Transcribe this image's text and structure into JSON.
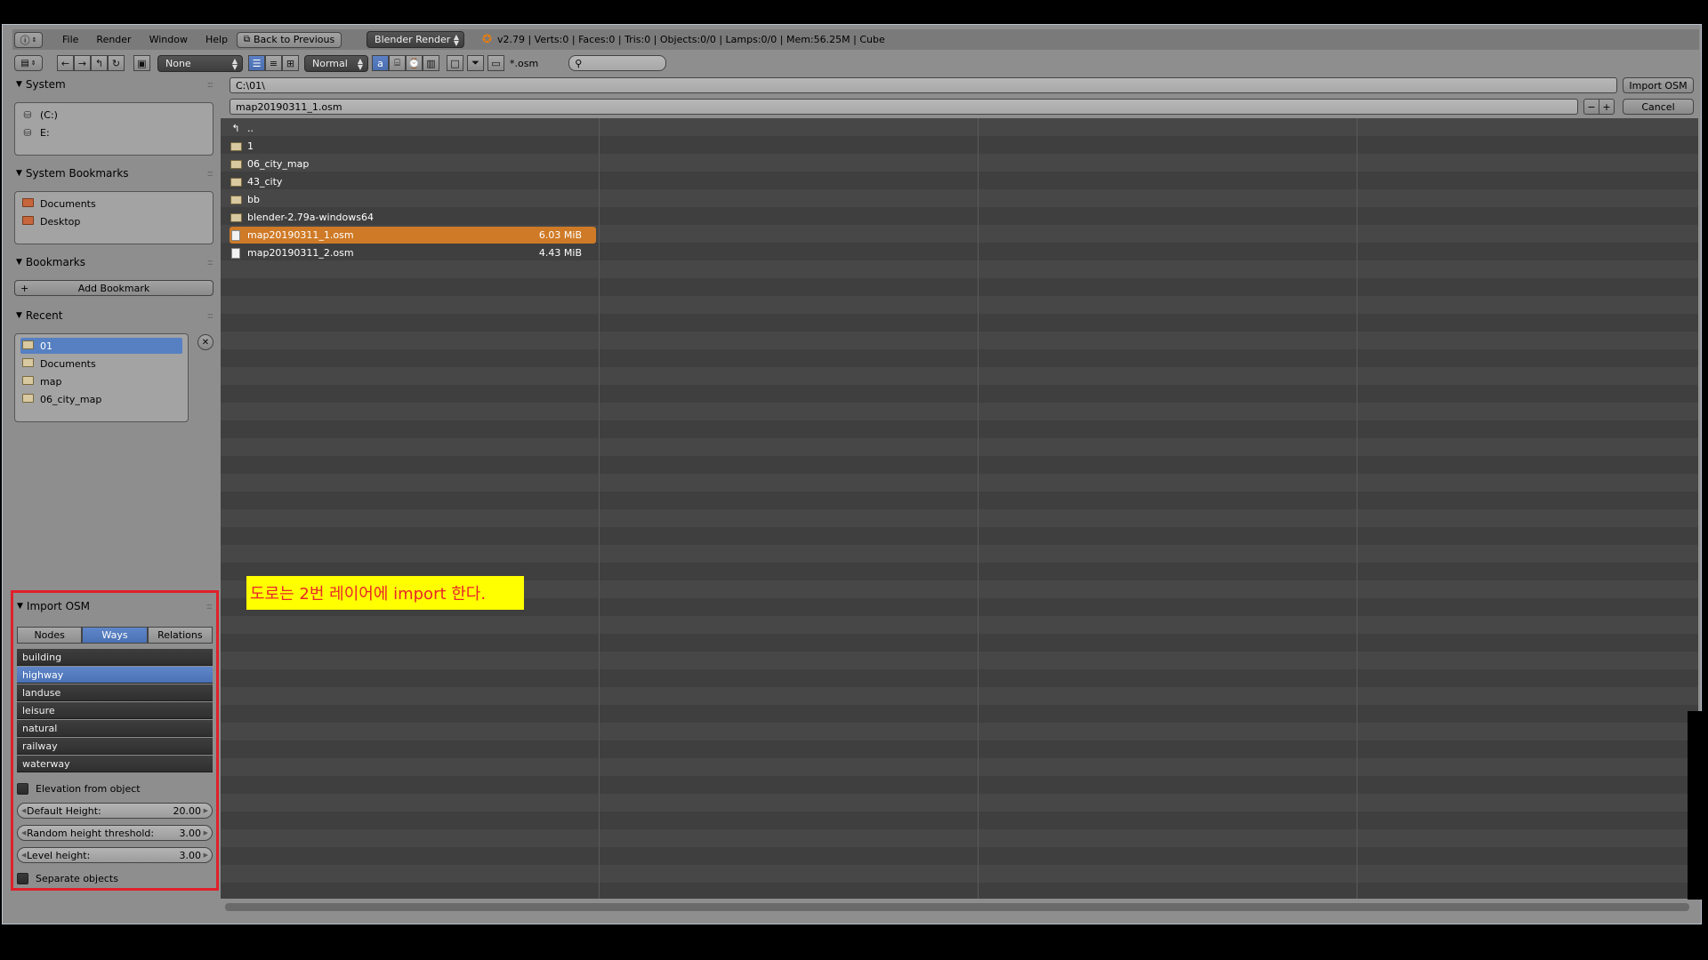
{
  "menubar": {
    "items": [
      "File",
      "Render",
      "Window",
      "Help"
    ],
    "back_label": "Back to Previous",
    "render_engine": "Blender Render",
    "status": "v2.79 | Verts:0 | Faces:0 | Tris:0 | Objects:0/0 | Lamps:0/0 | Mem:56.25M | Cube"
  },
  "toolbar": {
    "recursion": "None",
    "display_mode": "Normal",
    "filter_glob": "*.osm",
    "search_placeholder": ""
  },
  "path": {
    "directory": "C:\\01\\",
    "filename": "map20190311_1.osm",
    "import_label": "Import OSM",
    "cancel_label": "Cancel"
  },
  "sidebar": {
    "system": {
      "title": "System",
      "items": [
        "(C:)",
        "E:"
      ]
    },
    "system_bookmarks": {
      "title": "System Bookmarks",
      "items": [
        "Documents",
        "Desktop"
      ]
    },
    "bookmarks": {
      "title": "Bookmarks",
      "add_label": "Add Bookmark"
    },
    "recent": {
      "title": "Recent",
      "items": [
        "01",
        "Documents",
        "map",
        "06_city_map"
      ]
    }
  },
  "import_osm": {
    "title": "Import OSM",
    "tabs": [
      "Nodes",
      "Ways",
      "Relations"
    ],
    "ways": [
      "building",
      "highway",
      "landuse",
      "leisure",
      "natural",
      "railway",
      "waterway"
    ],
    "elevation_label": "Elevation from object",
    "fields": [
      {
        "label": "Default Height:",
        "value": "20.00"
      },
      {
        "label": "Random height threshold:",
        "value": "3.00"
      },
      {
        "label": "Level height:",
        "value": "3.00"
      }
    ],
    "separate_label": "Separate objects"
  },
  "files": {
    "parent": "..",
    "entries": [
      {
        "name": "1",
        "type": "folder",
        "size": ""
      },
      {
        "name": "06_city_map",
        "type": "folder",
        "size": ""
      },
      {
        "name": "43_city",
        "type": "folder",
        "size": ""
      },
      {
        "name": "bb",
        "type": "folder",
        "size": ""
      },
      {
        "name": "blender-2.79a-windows64",
        "type": "folder",
        "size": ""
      },
      {
        "name": "map20190311_1.osm",
        "type": "file",
        "size": "6.03 MiB"
      },
      {
        "name": "map20190311_2.osm",
        "type": "file",
        "size": "4.43 MiB"
      }
    ]
  },
  "annotation": "도로는 2번 레이어에 import 한다.",
  "colors": {
    "selected_file": "#cf7a26",
    "selected_blue": "#5680c2",
    "annotation_bg": "#ffff00",
    "annotation_text": "#e8262a",
    "highlight_border": "#e0202a"
  }
}
